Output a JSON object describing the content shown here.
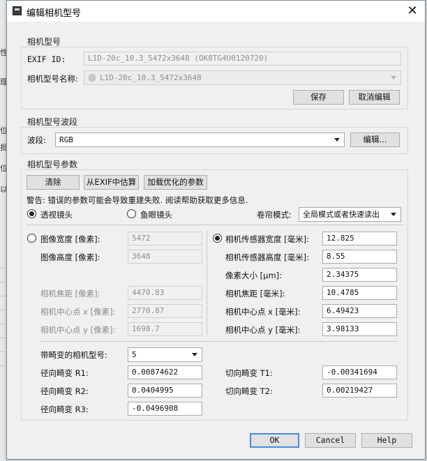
{
  "dialog": {
    "title": "编辑相机型号",
    "close_glyph": "✕"
  },
  "bg_app": {
    "visible_chars": [
      "性",
      "理",
      "位",
      "批",
      "位",
      "以"
    ]
  },
  "model_group": {
    "title": "相机型号",
    "exif_label": "EXIF ID:",
    "exif_value": "L1D-20c_10.3_5472x3648 (OK8TG4U0120720)",
    "name_label": "相机型号名称:",
    "name_value": "L1D-20c_10.3_5472x3648",
    "save_label": "保存",
    "cancel_edit_label": "取消编辑"
  },
  "band_group": {
    "title": "相机型号波段",
    "band_label": "波段:",
    "band_value": "RGB",
    "edit_label": "编辑..."
  },
  "params_group": {
    "title": "相机型号参数",
    "clear_label": "清除",
    "estimate_label": "从EXIF中估算",
    "load_label": "加载优化的参数",
    "warning": "警告: 错误的参数可能会导致重建失败. 阅读帮助获取更多信息.",
    "perspective_label": "透视镜头",
    "fisheye_label": "鱼眼镜头",
    "shutter_label": "卷帘模式:",
    "shutter_value": "全局模式或者快速读出",
    "left": {
      "image_width_label": "图像宽度 [像素]:",
      "image_width_value": "5472",
      "image_height_label": "图像高度 [像素]:",
      "image_height_value": "3648",
      "focal_px_label": "相机焦距 [像素]:",
      "focal_px_value": "4470.83",
      "cx_px_label": "相机中心点 x [像素]:",
      "cx_px_value": "2770.87",
      "cy_px_label": "相机中心点 y [像素]:",
      "cy_px_value": "1698.7"
    },
    "right": {
      "sensor_w_label": "相机传感器宽度 [毫米]:",
      "sensor_w_value": "12.825",
      "sensor_h_label": "相机传感器高度 [毫米]:",
      "sensor_h_value": "8.55",
      "pixel_size_label": "像素大小 [μm]:",
      "pixel_size_value": "2.34375",
      "focal_mm_label": "相机焦距 [毫米]:",
      "focal_mm_value": "10.4785",
      "cx_mm_label": "相机中心点 x [毫米]:",
      "cx_mm_value": "6.49423",
      "cy_mm_label": "相机中心点 y [毫米]:",
      "cy_mm_value": "3.98133"
    },
    "distortion": {
      "model_label": "带畸变的相机型号:",
      "model_value": "5",
      "r1_label": "径向畸变 R1:",
      "r1_value": "0.00874622",
      "r2_label": "径向畸变 R2:",
      "r2_value": "0.0404995",
      "r3_label": "径向畸变 R3:",
      "r3_value": "-0.0496908",
      "t1_label": "切向畸变 T1:",
      "t1_value": "-0.00341694",
      "t2_label": "切向畸变 T2:",
      "t2_value": "0.00219427"
    }
  },
  "footer": {
    "ok_label": "OK",
    "cancel_label": "Cancel",
    "help_label": "Help"
  }
}
